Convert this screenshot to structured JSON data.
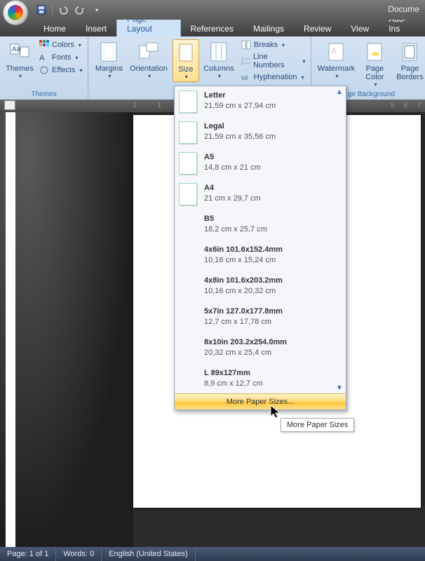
{
  "title": "Docume",
  "tabs": {
    "home": "Home",
    "insert": "Insert",
    "page_layout": "Page Layout",
    "references": "References",
    "mailings": "Mailings",
    "review": "Review",
    "view": "View",
    "addins": "Add-Ins"
  },
  "ribbon": {
    "themes": {
      "main": "Themes",
      "colors": "Colors",
      "fonts": "Fonts",
      "effects": "Effects",
      "group": "Themes"
    },
    "page_setup": {
      "margins": "Margins",
      "orientation": "Orientation",
      "size": "Size",
      "columns": "Columns",
      "breaks": "Breaks",
      "line_numbers": "Line Numbers",
      "hyphenation": "Hyphenation"
    },
    "background": {
      "watermark": "Watermark",
      "page_color": "Page Color",
      "page_borders": "Page Borders",
      "group": "ge Background"
    }
  },
  "size_menu": {
    "items": [
      {
        "name": "Letter",
        "dim": "21,59 cm x 27,94 cm",
        "icon": true
      },
      {
        "name": "Legal",
        "dim": "21,59 cm x 35,56 cm",
        "icon": true
      },
      {
        "name": "A5",
        "dim": "14,8 cm x 21 cm",
        "icon": true
      },
      {
        "name": "A4",
        "dim": "21 cm x 29,7 cm",
        "icon": true
      },
      {
        "name": "B5",
        "dim": "18,2 cm x 25,7 cm",
        "icon": false
      },
      {
        "name": "4x6in 101.6x152.4mm",
        "dim": "10,16 cm x 15,24 cm",
        "icon": false
      },
      {
        "name": "4x8in 101.6x203.2mm",
        "dim": "10,16 cm x 20,32 cm",
        "icon": false
      },
      {
        "name": "5x7in 127.0x177.8mm",
        "dim": "12,7 cm x 17,78 cm",
        "icon": false
      },
      {
        "name": "8x10in 203.2x254.0mm",
        "dim": "20,32 cm x 25,4 cm",
        "icon": false
      },
      {
        "name": "L 89x127mm",
        "dim": "8,9 cm x 12,7 cm",
        "icon": false
      }
    ],
    "more": "More Paper Sizes..."
  },
  "tooltip": "More Paper Sizes",
  "ruler_left": [
    "2",
    "1"
  ],
  "ruler_right": [
    "5",
    "6",
    "7"
  ],
  "status": {
    "page": "Page: 1 of 1",
    "words": "Words: 0",
    "lang": "English (United States)"
  }
}
